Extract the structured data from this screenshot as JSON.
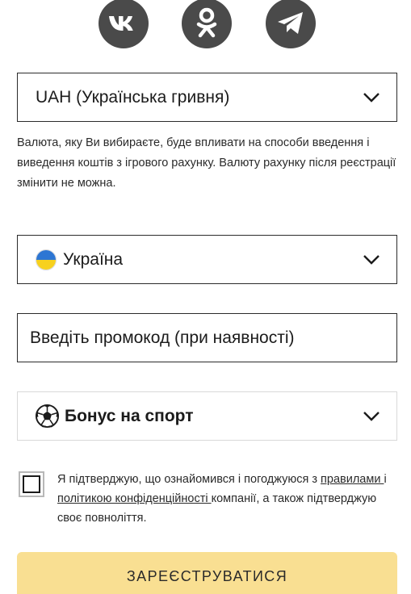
{
  "socials": [
    {
      "name": "vk",
      "icon": "vk-icon"
    },
    {
      "name": "odnoklassniki",
      "icon": "odnoklassniki-icon"
    },
    {
      "name": "telegram",
      "icon": "telegram-icon"
    }
  ],
  "currency": {
    "selected": "UAH (Українська гривня)",
    "note": "Валюта, яку Ви вибираєте, буде впливати на способи введення і виведення коштів з ігрового рахунку. Валюту рахунку після реєстрації змінити не можна."
  },
  "country": {
    "selected": "Україна",
    "flag_colors": [
      "#2d76d3",
      "#f7d11e"
    ]
  },
  "promo": {
    "placeholder": "Введіть промокод (при наявності)",
    "value": ""
  },
  "bonus": {
    "selected": "Бонус на спорт",
    "icon": "soccer-ball-icon"
  },
  "consent": {
    "checked": false,
    "text_before": "Я підтверджую, що ознайомився і погоджуюся з ",
    "rules_link": "правилами ",
    "text_middle": "і ",
    "privacy_link": "політикою конфіденційності ",
    "text_after": "компанії, а також підтверджую своє повноліття."
  },
  "register_button": {
    "label": "ЗАРЕЄСТРУВАТИСЯ",
    "color": "#f9df92"
  },
  "colors": {
    "social_icon_bg": "#4a4a4a",
    "border": "#2b2b2b"
  }
}
